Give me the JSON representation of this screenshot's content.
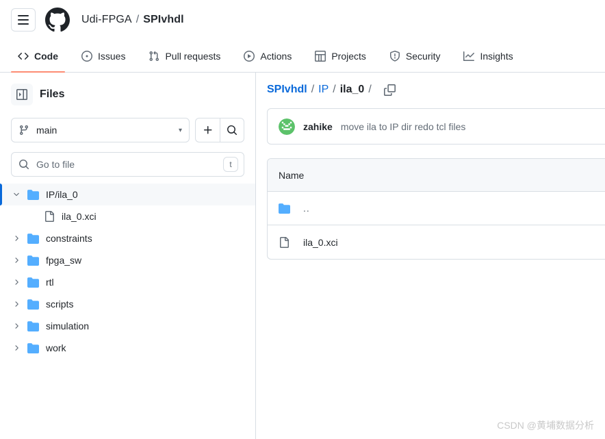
{
  "header": {
    "menu_icon": "hamburger-menu-icon",
    "logo_icon": "github-logo-icon",
    "owner": "Udi-FPGA",
    "separator": "/",
    "repo": "SPIvhdl"
  },
  "tabs": [
    {
      "label": "Code",
      "icon": "code-icon",
      "active": true
    },
    {
      "label": "Issues",
      "icon": "issue-opened-icon",
      "active": false
    },
    {
      "label": "Pull requests",
      "icon": "git-pull-request-icon",
      "active": false
    },
    {
      "label": "Actions",
      "icon": "play-icon",
      "active": false
    },
    {
      "label": "Projects",
      "icon": "table-icon",
      "active": false
    },
    {
      "label": "Security",
      "icon": "shield-icon",
      "active": false
    },
    {
      "label": "Insights",
      "icon": "graph-icon",
      "active": false
    }
  ],
  "sidebar": {
    "title": "Files",
    "collapse_icon": "sidebar-collapse-icon",
    "branch": {
      "icon": "git-branch-icon",
      "name": "main",
      "caret": "chevron-down-icon"
    },
    "add_button_label": "+",
    "search_button_icon": "search-icon",
    "filter": {
      "icon": "search-icon",
      "placeholder": "Go to file",
      "shortcut": "t"
    },
    "tree": [
      {
        "label": "IP/ila_0",
        "type": "folder",
        "expanded": true,
        "selected": true,
        "depth": 0
      },
      {
        "label": "ila_0.xci",
        "type": "file",
        "expanded": false,
        "selected": false,
        "depth": 1
      },
      {
        "label": "constraints",
        "type": "folder",
        "expanded": false,
        "selected": false,
        "depth": 0
      },
      {
        "label": "fpga_sw",
        "type": "folder",
        "expanded": false,
        "selected": false,
        "depth": 0
      },
      {
        "label": "rtl",
        "type": "folder",
        "expanded": false,
        "selected": false,
        "depth": 0
      },
      {
        "label": "scripts",
        "type": "folder",
        "expanded": false,
        "selected": false,
        "depth": 0
      },
      {
        "label": "simulation",
        "type": "folder",
        "expanded": false,
        "selected": false,
        "depth": 0
      },
      {
        "label": "work",
        "type": "folder",
        "expanded": false,
        "selected": false,
        "depth": 0
      }
    ]
  },
  "main": {
    "breadcrumb": {
      "repo": "SPIvhdl",
      "parts": [
        "IP",
        "ila_0"
      ],
      "separator": "/",
      "copy_icon": "copy-path-icon"
    },
    "commit": {
      "avatar_icon": "user-avatar-identicon",
      "author": "zahike",
      "message": "move ila to IP dir redo tcl files"
    },
    "table": {
      "columns": [
        "Name"
      ],
      "rows": [
        {
          "name": "..",
          "type": "folder"
        },
        {
          "name": "ila_0.xci",
          "type": "file"
        }
      ]
    }
  },
  "watermark": "CSDN @黄埔数据分析",
  "colors": {
    "accent_blue": "#0969da",
    "active_tab_underline": "#fd8c73",
    "folder_blue": "#54aeff",
    "border": "#d8dee4",
    "surface": "#f6f8fa",
    "text": "#1f2328",
    "muted_text": "#636c76",
    "avatar_green": "#5cc26a"
  }
}
